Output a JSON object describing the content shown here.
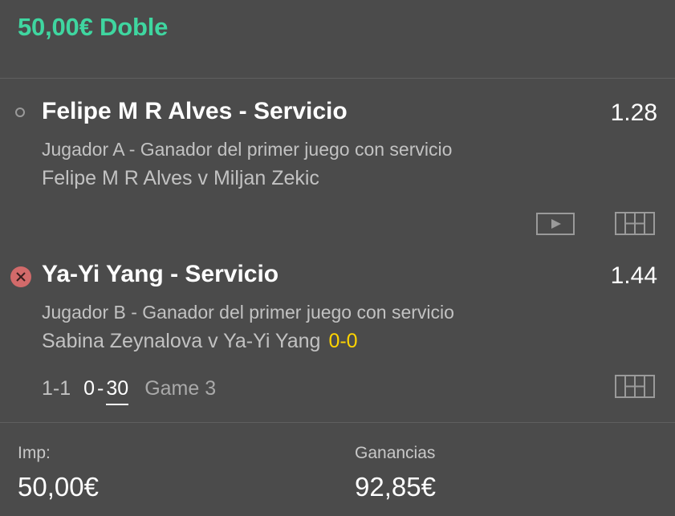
{
  "header": {
    "title": "50,00€ Doble"
  },
  "selections": [
    {
      "title": "Felipe M R Alves - Servicio",
      "odds": "1.28",
      "market": "Jugador A - Ganador del primer juego con servicio",
      "event": "Felipe M R Alves v Miljan Zekic",
      "status_icon": "open-circle-icon"
    },
    {
      "title": "Ya-Yi Yang - Servicio",
      "odds": "1.44",
      "market": "Jugador B - Ganador del primer juego con servicio",
      "event": "Sabina Zeynalova v Ya-Yi Yang",
      "live_score": "0-0",
      "status_icon": "lost-x-icon",
      "score_row": {
        "sets": "1-1",
        "points_a": "0",
        "points_sep": "-",
        "points_b": "30",
        "game": "Game 3"
      }
    }
  ],
  "footer": {
    "stake_label": "Imp:",
    "stake_value": "50,00€",
    "returns_label": "Ganancias",
    "returns_value": "92,85€"
  },
  "colors": {
    "background": "#4b4b4b",
    "accent": "#3fd6a0",
    "live_score": "#ffd400",
    "lost": "#d26a6a"
  }
}
